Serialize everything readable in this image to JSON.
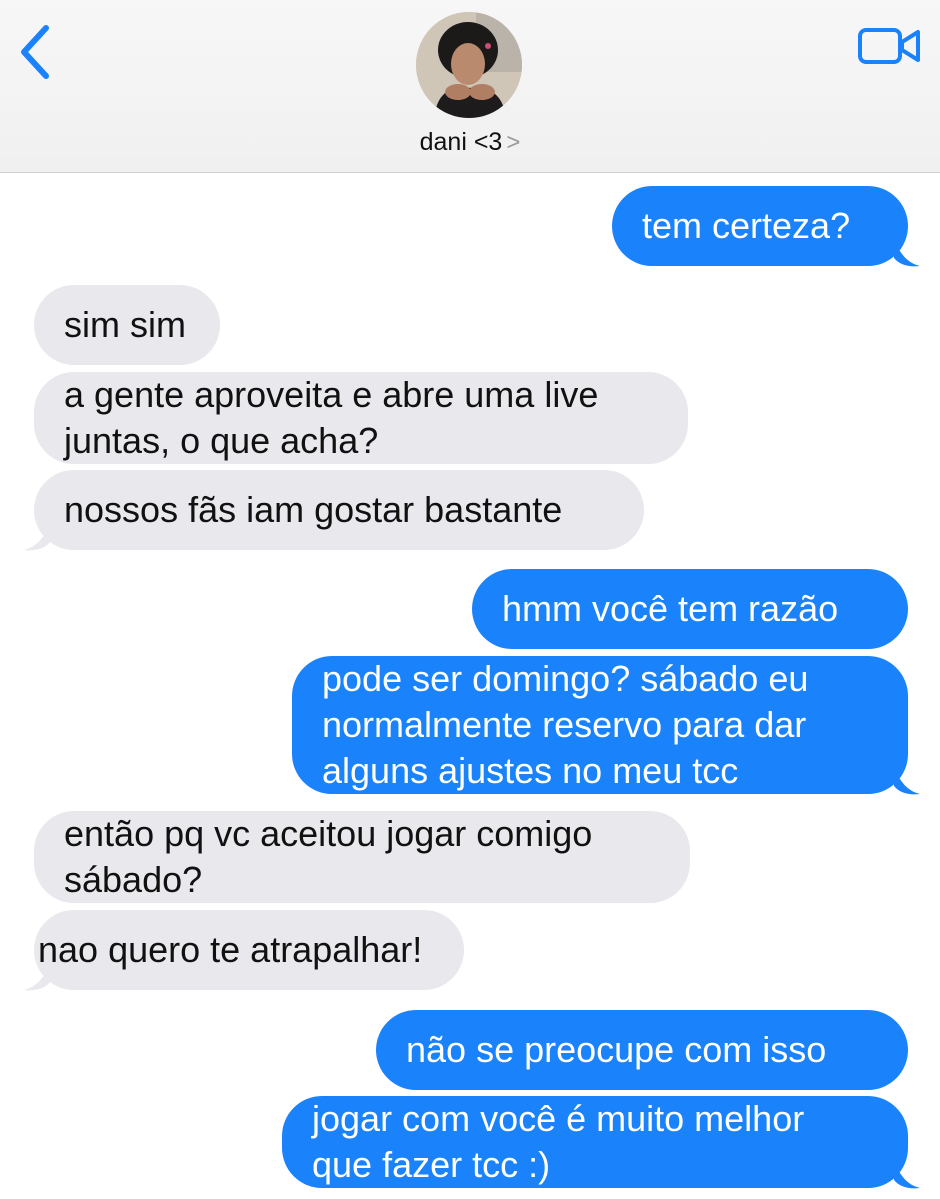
{
  "header": {
    "contact_name": "dani <3",
    "contact_chevron": ">",
    "back_icon": "chevron-left-icon",
    "video_icon": "video-camera-icon",
    "accent_color": "#1a82fb"
  },
  "messages": [
    {
      "from": "me",
      "text": "tem certeza?"
    },
    {
      "from": "contact",
      "text": "sim sim"
    },
    {
      "from": "contact",
      "lines": [
        "a gente aproveita e abre uma live",
        "juntas, o que acha?"
      ]
    },
    {
      "from": "contact",
      "text": "nossos fãs iam gostar bastante"
    },
    {
      "from": "me",
      "text": "hmm você tem razão"
    },
    {
      "from": "me",
      "lines": [
        "pode ser domingo? sábado eu",
        "normalmente reservo para dar",
        "alguns ajustes no meu tcc"
      ]
    },
    {
      "from": "contact",
      "lines": [
        "então pq vc aceitou jogar comigo",
        "sábado?"
      ]
    },
    {
      "from": "contact",
      "text": "nao quero te atrapalhar!"
    },
    {
      "from": "me",
      "text": "não se preocupe com isso"
    },
    {
      "from": "me",
      "lines": [
        "jogar com você é muito melhor",
        "que fazer tcc :)"
      ]
    }
  ],
  "colors": {
    "sent_bubble": "#1a82fb",
    "received_bubble": "#e8e8ed"
  }
}
